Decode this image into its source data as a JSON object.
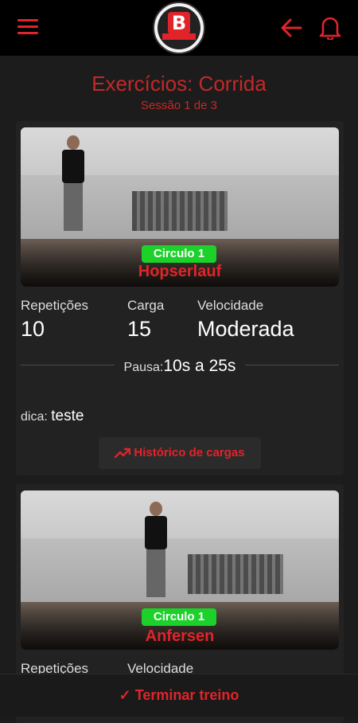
{
  "header": {
    "menu_icon": "hamburger-menu-icon",
    "logo_letter": "B",
    "back_icon": "arrow-left-icon",
    "bell_icon": "bell-icon",
    "accent_color": "#e0242a"
  },
  "page": {
    "title": "Exercícios: Corrida",
    "subtitle": "Sessão 1 de 3"
  },
  "exercises": [
    {
      "circuit": "Circulo 1",
      "name": "Hopserlauf",
      "stats": [
        {
          "label": "Repetições",
          "value": "10"
        },
        {
          "label": "Carga",
          "value": "15"
        },
        {
          "label": "Velocidade",
          "value": "Moderada"
        }
      ],
      "pause_label": "Pausa:",
      "pause_value": "10s a 25s",
      "tip_label": "dica:",
      "tip_value": "teste",
      "history_button": "Histórico de cargas",
      "history_icon": "trending-up-icon"
    },
    {
      "circuit": "Circulo 1",
      "name": "Anfersen",
      "stats": [
        {
          "label": "Repetições"
        },
        {
          "label": "Velocidade"
        }
      ]
    }
  ],
  "footer": {
    "finish_button": "✓ Terminar treino"
  },
  "colors": {
    "badge_green": "#1bd12a",
    "background": "#1c1c1c"
  }
}
